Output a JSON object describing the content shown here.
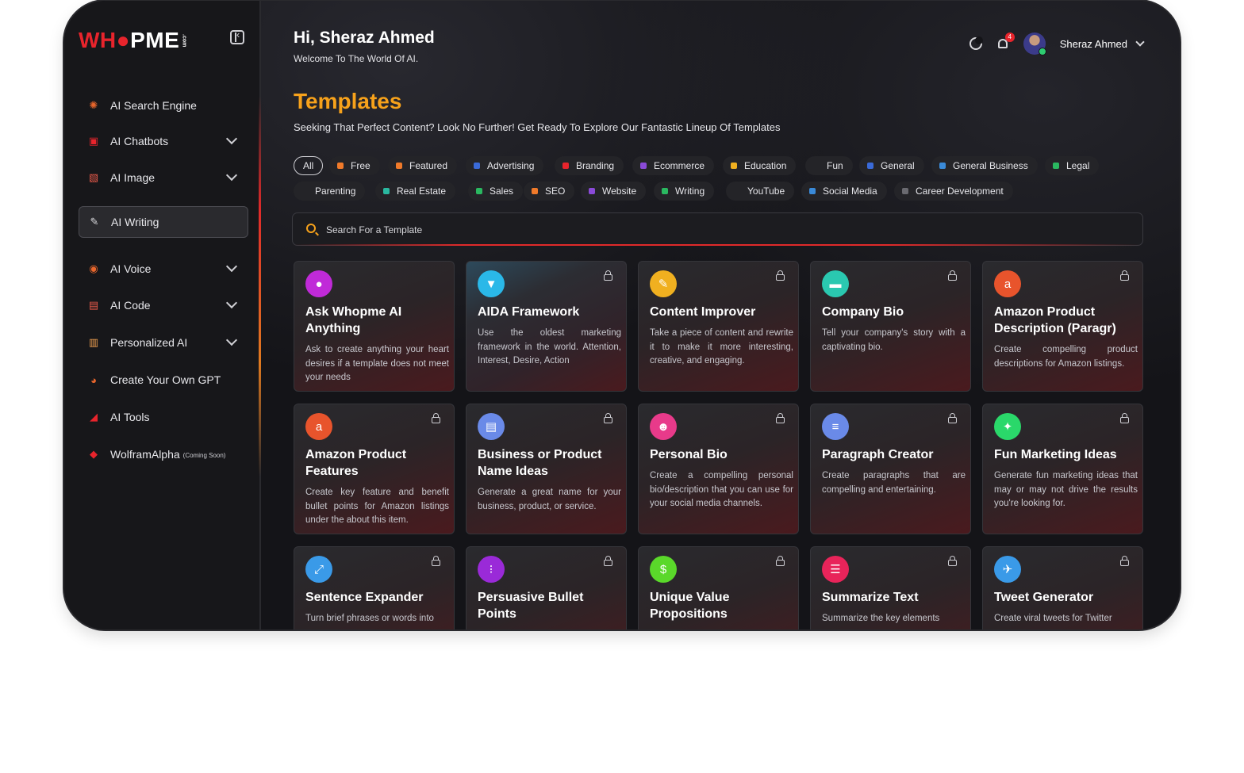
{
  "brand": {
    "logo_text_a": "WH",
    "logo_text_b": "PME",
    "logo_suffix": ".com",
    "accent": "#e8242c",
    "highlight": "#f7a21b"
  },
  "sidebar": {
    "items": [
      {
        "label": "AI Search Engine",
        "icon": "search-engine-icon",
        "chevron": false,
        "color": "#e8662c"
      },
      {
        "label": "AI Chatbots",
        "icon": "chatbot-icon",
        "chevron": true,
        "color": "#e8242c"
      },
      {
        "label": "AI Image",
        "icon": "image-icon",
        "chevron": true,
        "color": "#e85a4a"
      },
      {
        "label": "AI Writing",
        "icon": "writing-icon",
        "chevron": false,
        "active": true,
        "color": "#dcdce0"
      },
      {
        "label": "AI Voice",
        "icon": "voice-icon",
        "chevron": true,
        "color": "#e8662c"
      },
      {
        "label": "AI Code",
        "icon": "code-icon",
        "chevron": true,
        "color": "#e85a4a"
      },
      {
        "label": "Personalized AI",
        "icon": "personalized-icon",
        "chevron": true,
        "color": "#f0a050"
      },
      {
        "label": "Create Your Own GPT",
        "icon": "gpt-icon",
        "chevron": false,
        "color": "#e8662c"
      },
      {
        "label": "AI Tools",
        "icon": "tools-icon",
        "chevron": false,
        "color": "#e8242c"
      },
      {
        "label": "WolframAlpha",
        "icon": "wolfram-icon",
        "chevron": false,
        "note": "(Coming Soon)",
        "color": "#e8242c"
      }
    ]
  },
  "header": {
    "greeting": "Hi, Sheraz Ahmed",
    "welcome": "Welcome To The World Of AI.",
    "notification_count": "4",
    "user_name": "Sheraz Ahmed"
  },
  "page": {
    "title": "Templates",
    "subtitle": "Seeking That Perfect Content? Look No Further! Get Ready To Explore Our Fantastic Lineup Of Templates"
  },
  "filters": [
    {
      "label": "All",
      "color": ""
    },
    {
      "label": "Free",
      "color": "#f07a2a"
    },
    {
      "label": "Featured",
      "color": "#f07a2a"
    },
    {
      "label": "Advertising",
      "color": "#3a6ad8"
    },
    {
      "label": "Branding",
      "color": "#e8242c"
    },
    {
      "label": "Ecommerce",
      "color": "#8a4ad8"
    },
    {
      "label": "Education",
      "color": "#f0b020"
    },
    {
      "label": "Fun",
      "color": ""
    },
    {
      "label": "General",
      "color": "#3a6ad8"
    },
    {
      "label": "General Business",
      "color": "#3a8ad8"
    },
    {
      "label": "Legal",
      "color": "#2ab860"
    },
    {
      "label": "Parenting",
      "color": ""
    },
    {
      "label": "Real Estate",
      "color": "#2ab8a0"
    },
    {
      "label": "Sales",
      "color": "#2ab860"
    },
    {
      "label": "SEO",
      "color": "#f07a2a"
    },
    {
      "label": "Website",
      "color": "#8a4ad8"
    },
    {
      "label": "Writing",
      "color": "#2ab860"
    },
    {
      "label": "YouTube",
      "color": ""
    },
    {
      "label": "Social Media",
      "color": "#3a8ad8"
    },
    {
      "label": "Career Development",
      "color": "#6a6a70"
    }
  ],
  "search": {
    "placeholder": "Search For a Template"
  },
  "cards": [
    {
      "title": "Ask Whopme AI Anything",
      "desc": "Ask to create anything your heart desires if a template does not meet your needs",
      "icon": "chat-bubble-icon",
      "color": "#c02ad8",
      "locked": false
    },
    {
      "title": "AIDA Framework",
      "desc": "Use the oldest marketing framework in the world. Attention, Interest, Desire, Action",
      "icon": "funnel-icon",
      "color": "#2ab8e8",
      "locked": true
    },
    {
      "title": "Content Improver",
      "desc": "Take a piece of content and rewrite it to make it more interesting, creative, and engaging.",
      "icon": "edit-doc-icon",
      "color": "#f0b020",
      "locked": true
    },
    {
      "title": "Company Bio",
      "desc": "Tell your company's story with a captivating bio.",
      "icon": "briefcase-icon",
      "color": "#2ac8b0",
      "locked": true
    },
    {
      "title": "Amazon Product Description (Paragr)",
      "desc": "Create compelling product descriptions for Amazon listings.",
      "icon": "amazon-icon",
      "color": "#e8542c",
      "locked": true
    },
    {
      "title": "Amazon Product Features",
      "desc": "Create key feature and benefit bullet points for Amazon listings under the about this item.",
      "icon": "amazon-icon",
      "color": "#e8542c",
      "locked": true
    },
    {
      "title": "Business or Product Name Ideas",
      "desc": "Generate a great name for your business, product, or service.",
      "icon": "id-card-icon",
      "color": "#6a8ae8",
      "locked": true
    },
    {
      "title": "Personal Bio",
      "desc": "Create a compelling personal bio/description that you can use for your social media channels.",
      "icon": "person-icon",
      "color": "#e83a8a",
      "locked": true
    },
    {
      "title": "Paragraph Creator",
      "desc": "Create paragraphs that are compelling and entertaining.",
      "icon": "paragraph-icon",
      "color": "#6a8ae8",
      "locked": true
    },
    {
      "title": "Fun Marketing Ideas",
      "desc": "Generate fun marketing ideas that may or may not drive the results you're looking for.",
      "icon": "idea-icon",
      "color": "#2ad86a",
      "locked": true
    },
    {
      "title": "Sentence Expander",
      "desc": "Turn brief phrases or words into",
      "icon": "expand-icon",
      "color": "#3a9ae8",
      "locked": true
    },
    {
      "title": "Persuasive Bullet Points",
      "desc": "",
      "icon": "bullet-list-icon",
      "color": "#9a2ad8",
      "locked": true
    },
    {
      "title": "Unique Value Propositions",
      "desc": "",
      "icon": "value-icon",
      "color": "#5ad82a",
      "locked": true
    },
    {
      "title": "Summarize Text",
      "desc": "Summarize the key elements",
      "icon": "summary-icon",
      "color": "#e8245a",
      "locked": true
    },
    {
      "title": "Tweet Generator",
      "desc": "Create viral tweets for Twitter",
      "icon": "twitter-icon",
      "color": "#3a9ae8",
      "locked": true
    }
  ]
}
